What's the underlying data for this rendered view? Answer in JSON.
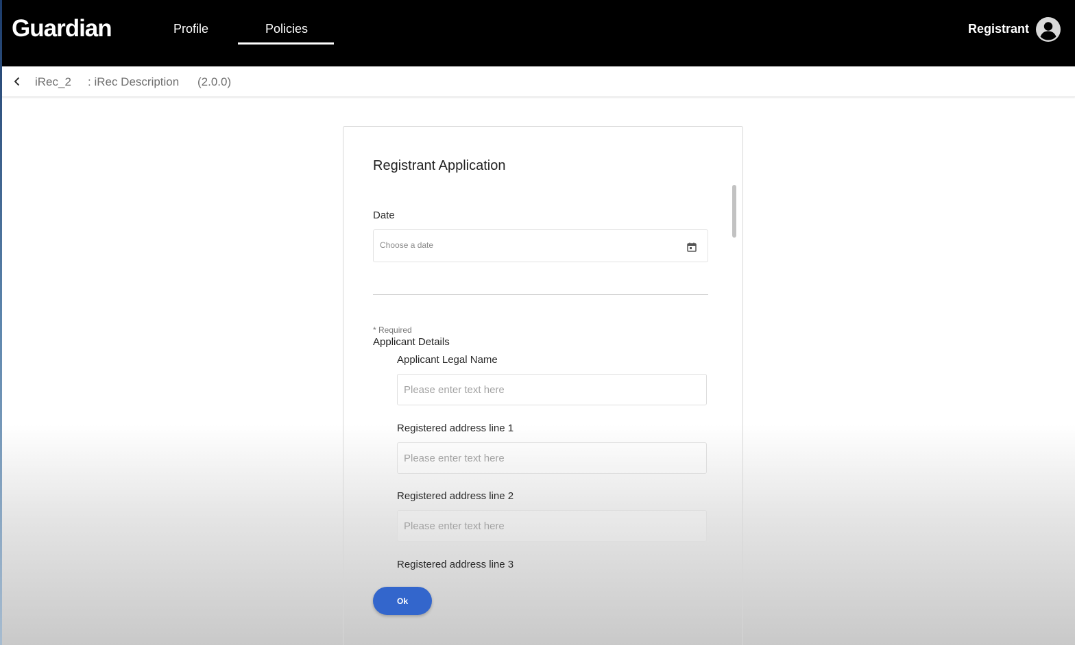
{
  "header": {
    "logo": "Guardian",
    "nav": [
      {
        "label": "Profile",
        "active": false
      },
      {
        "label": "Policies",
        "active": true
      }
    ],
    "user_label": "Registrant",
    "avatar_icon": "account-circle-icon"
  },
  "breadcrumb": {
    "back_icon": "chevron-left-icon",
    "policy_name": "iRec_2",
    "description": ": iRec Description",
    "version": "(2.0.0)"
  },
  "form": {
    "title": "Registrant Application",
    "date": {
      "label": "Date",
      "placeholder": "Choose a date",
      "icon": "calendar-icon"
    },
    "required_note": "* Required",
    "section_label": "Applicant Details",
    "fields": [
      {
        "label": "Applicant Legal Name",
        "placeholder": "Please enter text here",
        "value": ""
      },
      {
        "label": "Registered address line 1",
        "placeholder": "Please enter text here",
        "value": ""
      },
      {
        "label": "Registered address line 2",
        "placeholder": "Please enter text here",
        "value": ""
      },
      {
        "label": "Registered address line 3"
      }
    ],
    "ok_label": "Ok"
  },
  "colors": {
    "topbar": "#000000",
    "button": "#3366cc"
  }
}
